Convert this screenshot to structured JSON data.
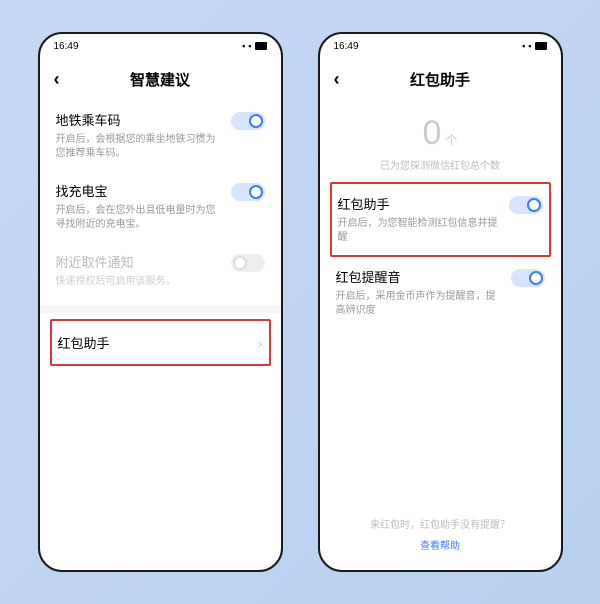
{
  "status": {
    "time": "16:49",
    "icons": "⚙ ⬚ ▮"
  },
  "left": {
    "title": "智慧建议",
    "items": [
      {
        "title": "地铁乘车码",
        "desc": "开启后，会根据您的乘坐地铁习惯为您推荐乘车码。",
        "on": true,
        "disabled": false
      },
      {
        "title": "找充电宝",
        "desc": "开启后，会在您外出且低电量时为您寻找附近的充电宝。",
        "on": true,
        "disabled": false
      },
      {
        "title": "附近取件通知",
        "desc": "快递授权后可启用该服务。",
        "on": false,
        "disabled": true
      }
    ],
    "nav": {
      "label": "红包助手"
    }
  },
  "right": {
    "title": "红包助手",
    "counter": {
      "value": "0",
      "unit": "个",
      "desc": "已为您探测微信红包总个数"
    },
    "items": [
      {
        "title": "红包助手",
        "desc": "开启后，为您智能检测红包信息并提醒",
        "on": true
      },
      {
        "title": "红包提醒音",
        "desc": "开启后，采用金币声作为提醒音，提高辨识度",
        "on": true
      }
    ],
    "footer": {
      "question": "来红包时，红包助手没有提醒？",
      "link": "查看帮助"
    }
  }
}
